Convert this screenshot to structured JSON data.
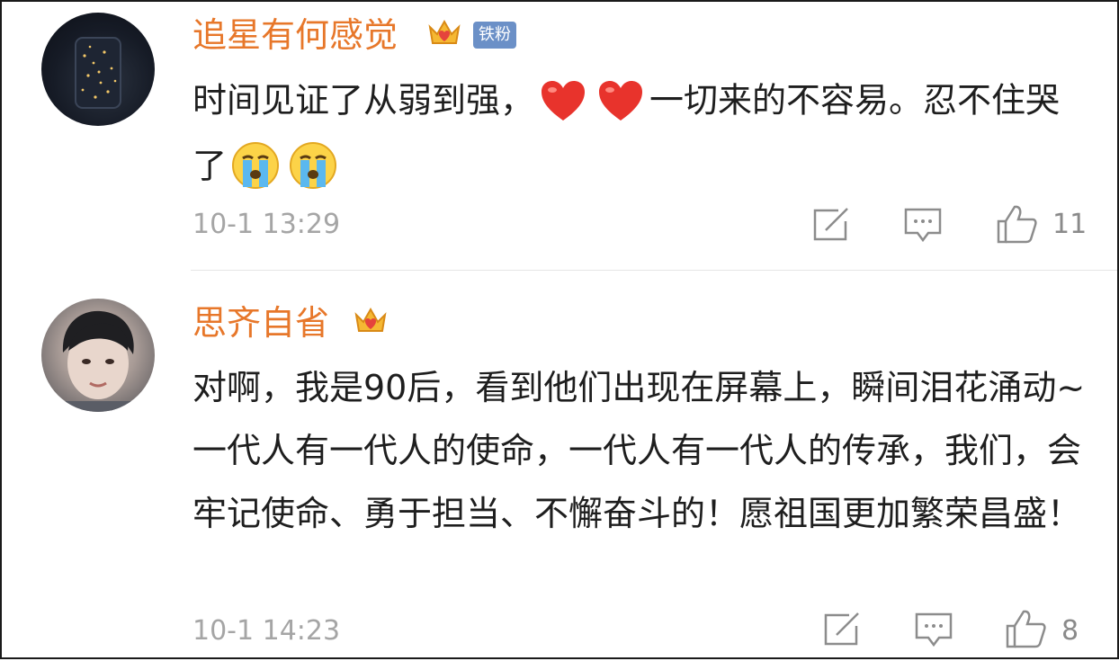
{
  "comments": [
    {
      "username": "追星有何感觉",
      "badge": "铁粉",
      "text_a": "时间见证了从弱到强，",
      "text_b": "一切来的不容易。忍不住哭了",
      "time": "10-1 13:29",
      "likes": "11"
    },
    {
      "username": "思齐自省",
      "text": "对啊，我是90后，看到他们出现在屏幕上，瞬间泪花涌动~一代人有一代人的使命，一代人有一代人的传承，我们，会牢记使命、勇于担当、不懈奋斗的！愿祖国更加繁荣昌盛！",
      "time": "10-1 14:23",
      "likes": "8"
    }
  ],
  "colors": {
    "username": "#e7772a",
    "badge_bg": "#6b90c7",
    "meta": "#a5a5a5",
    "text": "#1e1e1e"
  }
}
